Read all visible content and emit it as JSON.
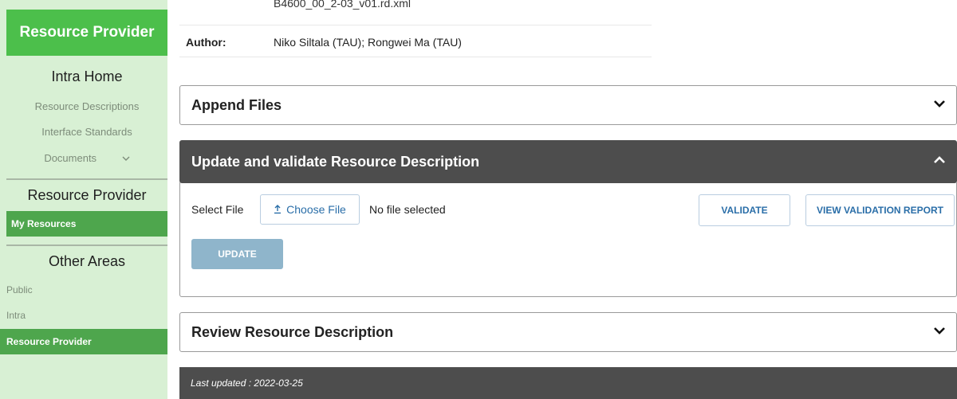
{
  "sidebar": {
    "header": "Resource Provider",
    "intra_home": {
      "title": "Intra Home",
      "links": [
        "Resource Descriptions",
        "Interface Standards",
        "Documents"
      ]
    },
    "resource_provider": {
      "title": "Resource Provider",
      "items": [
        "My Resources"
      ]
    },
    "other_areas": {
      "title": "Other Areas",
      "items": [
        "Public",
        "Intra",
        "Resource Provider"
      ]
    }
  },
  "meta": {
    "cut_filename": "B4600_00_2-03_v01.rd.xml",
    "author_label": "Author:",
    "author_value": "Niko Siltala (TAU); Rongwei Ma (TAU)"
  },
  "panels": {
    "append": "Append Files",
    "update": "Update and validate Resource Description",
    "review": "Review Resource Description"
  },
  "update_form": {
    "select_label": "Select File",
    "choose_button": "Choose File",
    "no_file": "No file selected",
    "validate_button": "VALIDATE",
    "report_button": "VIEW VALIDATION REPORT",
    "update_button": "UPDATE"
  },
  "footer": {
    "last_updated": "Last updated : 2022-03-25"
  },
  "colors": {
    "sidebar_bg": "#d8f0d4",
    "brand_green": "#4cbf4b",
    "active_green": "#4ea64d",
    "dark_panel": "#4d4d4d",
    "link_blue": "#2a6ea8"
  }
}
